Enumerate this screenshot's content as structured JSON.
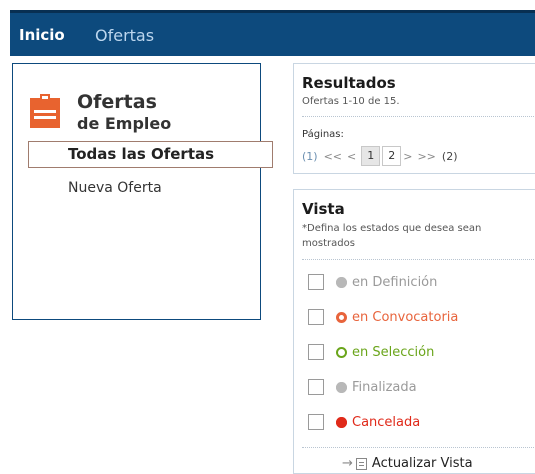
{
  "topnav": {
    "items": [
      {
        "label": "Inicio"
      },
      {
        "label": "Ofertas"
      }
    ]
  },
  "sidebar": {
    "logo_icon": "briefcase-icon",
    "brand_title": "Ofertas",
    "brand_sub": "de Empleo",
    "menu": [
      {
        "label": "Todas las Ofertas"
      },
      {
        "label": "Nueva Oferta"
      }
    ]
  },
  "results": {
    "title": "Resultados",
    "summary": "Ofertas 1-10 de 15.",
    "pages_label": "Páginas:",
    "current_marker": "(1)",
    "first_arrows": "<<",
    "prev_arrow": "<",
    "pages": [
      "1",
      "2"
    ],
    "next_arrow": ">",
    "last_arrows": ">>",
    "total_pages": "(2)"
  },
  "vista": {
    "title": "Vista",
    "description": "*Defina los estados que desea sean mostrados",
    "states": [
      {
        "label": "en Definición",
        "color": "#9a9a9a",
        "dot_fill": "#b8b8b8"
      },
      {
        "label": "en Convocatoria",
        "color": "#e8643c",
        "dot_fill": "#e8643c"
      },
      {
        "label": "en Selección",
        "color": "#6aa51a",
        "dot_fill": "#6aa51a"
      },
      {
        "label": "Finalizada",
        "color": "#9a9a9a",
        "dot_fill": "#b8b8b8"
      },
      {
        "label": "Cancelada",
        "color": "#e02a1a",
        "dot_fill": "#e02a1a"
      }
    ],
    "update_label": "Actualizar Vista"
  },
  "colors": {
    "nav_bg": "#0d4a7d",
    "brand_orange": "#e8632f"
  }
}
